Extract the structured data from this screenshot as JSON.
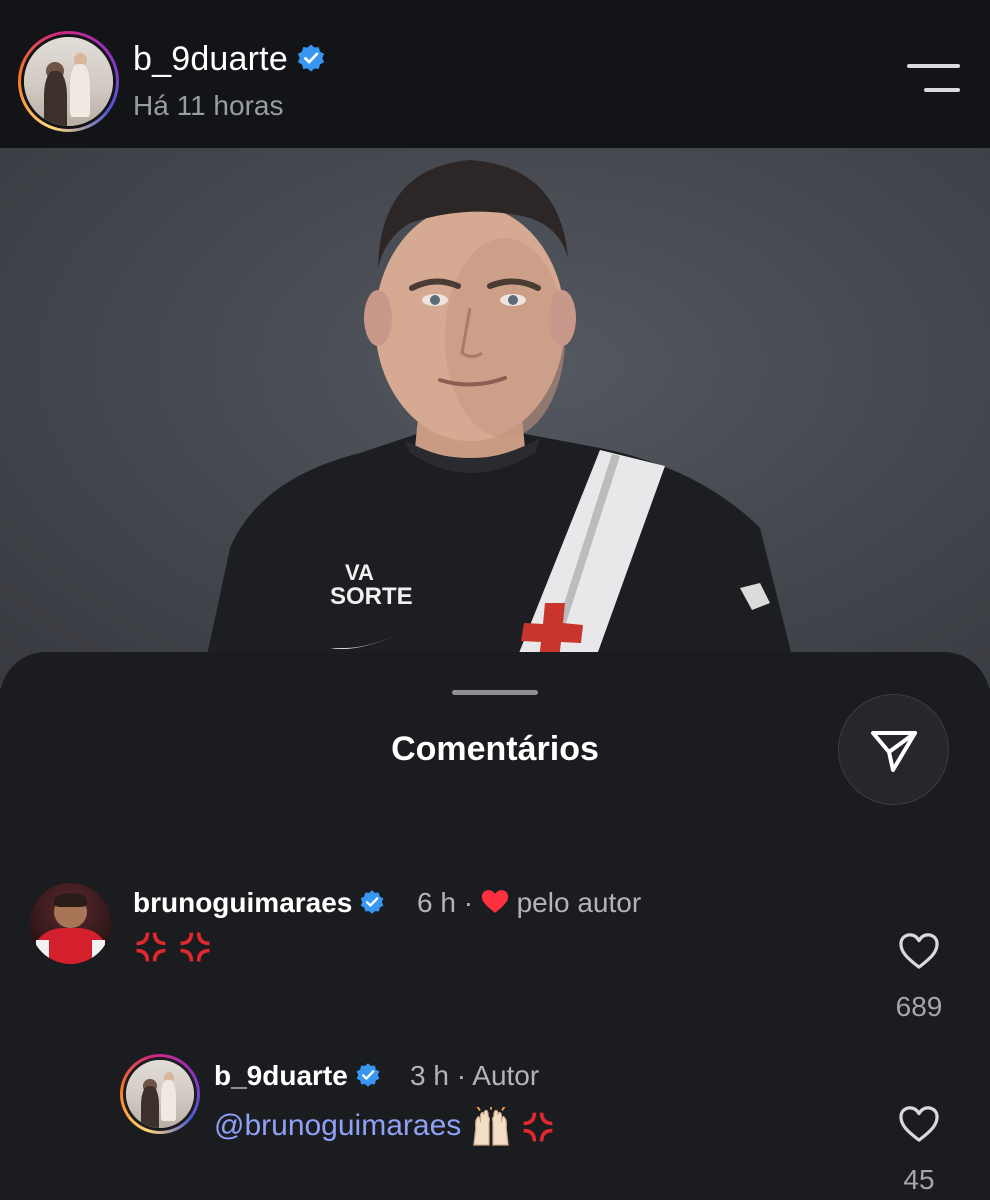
{
  "header": {
    "username": "b_9duarte",
    "verified": true,
    "time_label": "Há 11 horas"
  },
  "photo": {
    "shirt_text_line1": "VA",
    "shirt_text_line2": "SORTE"
  },
  "sheet": {
    "title": "Comentários"
  },
  "comments": [
    {
      "username": "brunoguimaraes",
      "verified": true,
      "time": "6 h",
      "separator": "·",
      "liked_by_author_label": "pelo autor",
      "text_emojis": [
        "anger-symbol",
        "anger-symbol"
      ],
      "likes": "689"
    },
    {
      "username": "b_9duarte",
      "verified": true,
      "time": "3 h",
      "separator": "·",
      "author_label": "Autor",
      "mention": "@brunoguimaraes",
      "text_emojis": [
        "raising-hands",
        "anger-symbol"
      ],
      "likes": "45"
    }
  ],
  "colors": {
    "background": "#1b1c20",
    "header_bg": "#131417",
    "verified_blue": "#3897f0",
    "mention_blue": "#8ea1f5",
    "heart_red": "#ff3040"
  }
}
